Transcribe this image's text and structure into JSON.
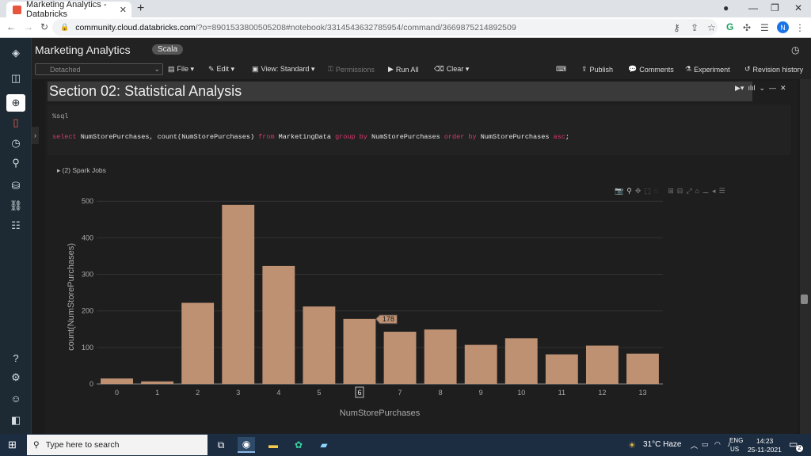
{
  "browser": {
    "tab_title": "Marketing Analytics - Databricks",
    "tab_close": "✕",
    "new_tab": "+",
    "url_host": "community.cloud.databricks.com",
    "url_path": "/?o=8901533800505208#notebook/3314543632785954/command/3669875214892509",
    "avatar_letter": "N",
    "favicon_color": "#e8553d"
  },
  "notebook": {
    "title": "Marketing Analytics",
    "language": "Scala",
    "cluster": "Detached",
    "toolbar": {
      "file": "File ▾",
      "edit": "Edit ▾",
      "view": "View: Standard ▾",
      "permissions": "Permissions",
      "run_all": "Run All",
      "clear": "Clear ▾",
      "publish": "Publish",
      "comments": "Comments",
      "experiment": "Experiment",
      "revision_history": "Revision history"
    }
  },
  "cell": {
    "section_title": "Section 02: Statistical Analysis",
    "magic": "%sql",
    "query_tokens": [
      {
        "t": "select",
        "k": "kw"
      },
      {
        "t": " NumStorePurchases, count(NumStorePurchases) ",
        "k": "id"
      },
      {
        "t": "from",
        "k": "kw"
      },
      {
        "t": " MarketingData ",
        "k": "id"
      },
      {
        "t": "group by",
        "k": "kw"
      },
      {
        "t": " NumStorePurchases ",
        "k": "id"
      },
      {
        "t": "order by",
        "k": "kw"
      },
      {
        "t": " NumStorePurchases ",
        "k": "id"
      },
      {
        "t": "asc",
        "k": "kw"
      },
      {
        "t": ";",
        "k": "id"
      }
    ],
    "spark_jobs": "▸ (2) Spark Jobs"
  },
  "chart_data": {
    "type": "bar",
    "categories": [
      "0",
      "1",
      "2",
      "3",
      "4",
      "5",
      "6",
      "7",
      "8",
      "9",
      "10",
      "11",
      "12",
      "13"
    ],
    "values": [
      15,
      7,
      222,
      490,
      323,
      212,
      178,
      143,
      149,
      107,
      125,
      81,
      105,
      83
    ],
    "xlabel": "NumStorePurchases",
    "ylabel": "count(NumStorePurchases)",
    "ylim": [
      0,
      520
    ],
    "yticks": [
      0,
      100,
      200,
      300,
      400,
      500
    ],
    "hover": {
      "category": "6",
      "value": "178"
    },
    "bar_color": "#bf9173",
    "grid": true
  },
  "taskbar": {
    "search_placeholder": "Type here to search",
    "weather": "31°C  Haze",
    "lang_top": "ENG",
    "lang_bottom": "US",
    "time": "14:23",
    "date": "25-11-2021",
    "notif_count": "2"
  }
}
